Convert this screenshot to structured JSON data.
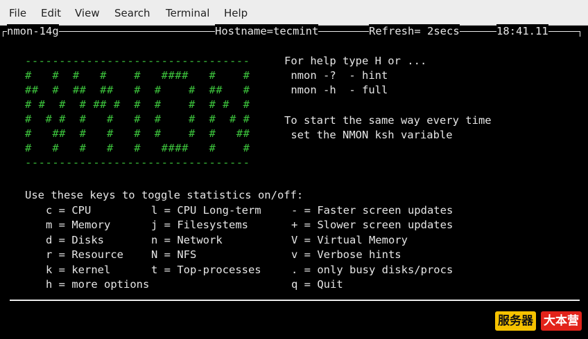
{
  "menu": [
    "File",
    "Edit",
    "View",
    "Search",
    "Terminal",
    "Help"
  ],
  "status_bar": {
    "name": "nmon-14g",
    "hostname": "Hostname=tecmint",
    "refresh": "Refresh= 2secs",
    "time": "18:41.11"
  },
  "logo": {
    "border": "---------------------------------",
    "rows": [
      "#   #  #   #    #   ####   #    #",
      "##  #  ##  ##   #  #    #  ##   #",
      "# #  #  # ## #  #  #    #  # #  #",
      "#  # #  #   #   #  #    #  #  # #",
      "#   ##  #   #   #  #    #  #   ##",
      "#   #   #   #   #   ####   #    #"
    ]
  },
  "help": {
    "line1": "For help type H or ...",
    "line2": " nmon -?  - hint",
    "line3": " nmon -h  - full",
    "line4": "To start the same way every time",
    "line5": " set the NMON ksh variable"
  },
  "keys": {
    "heading": "Use these keys to toggle statistics on/off:",
    "col1": [
      "c = CPU",
      "m = Memory",
      "d = Disks",
      "r = Resource",
      "k = kernel",
      "h = more options"
    ],
    "col2": [
      "l = CPU Long-term",
      "j = Filesystems",
      "n = Network",
      "N = NFS",
      "t = Top-processes"
    ],
    "col3": [
      "- = Faster screen updates",
      "+ = Slower screen updates",
      "V = Virtual Memory",
      "v = Verbose hints",
      ". = only busy disks/procs",
      "q = Quit"
    ]
  },
  "watermark": {
    "left": "服务器",
    "right": "大本营"
  },
  "colors": {
    "logo": "#3cc33c",
    "badge_left": "#f6c200",
    "badge_right": "#e2231a"
  }
}
